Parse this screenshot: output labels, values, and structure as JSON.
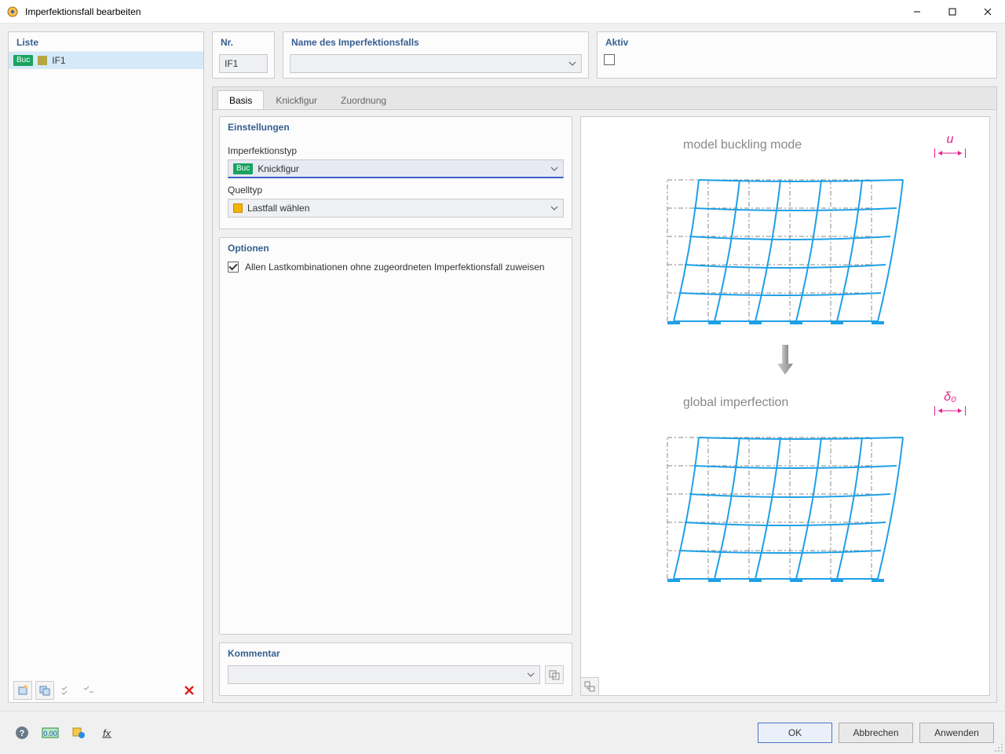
{
  "window": {
    "title": "Imperfektionsfall bearbeiten"
  },
  "left": {
    "header": "Liste",
    "items": [
      {
        "tag": "Buc",
        "label": "IF1"
      }
    ]
  },
  "top": {
    "nr_label": "Nr.",
    "nr_value": "IF1",
    "name_label": "Name des Imperfektionsfalls",
    "name_value": "",
    "aktiv_label": "Aktiv"
  },
  "tabs": {
    "items": [
      "Basis",
      "Knickfigur",
      "Zuordnung"
    ],
    "active": 0
  },
  "settings": {
    "header": "Einstellungen",
    "type_label": "Imperfektionstyp",
    "type_tag": "Buc",
    "type_value": "Knickfigur",
    "source_label": "Quelltyp",
    "source_value": "Lastfall wählen"
  },
  "options": {
    "header": "Optionen",
    "assign_label": "Allen Lastkombinationen ohne zugeordneten Imperfektionsfall zuweisen",
    "assign_checked": true
  },
  "comment": {
    "header": "Kommentar",
    "value": ""
  },
  "preview": {
    "caption_top": "model buckling mode",
    "symbol_top": "u",
    "caption_bottom": "global imperfection",
    "symbol_bottom": "δ₀"
  },
  "footer": {
    "ok": "OK",
    "cancel": "Abbrechen",
    "apply": "Anwenden"
  }
}
